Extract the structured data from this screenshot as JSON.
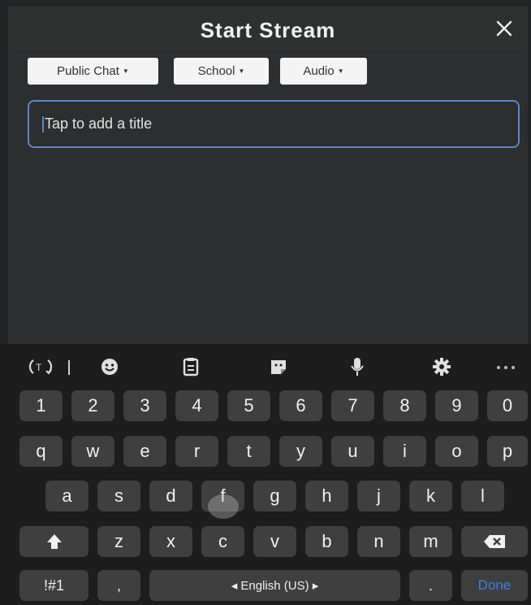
{
  "header": {
    "title": "Start Stream"
  },
  "chips": [
    {
      "label": "Public Chat"
    },
    {
      "label": "School"
    },
    {
      "label": "Audio"
    }
  ],
  "title_input": {
    "placeholder": "Tap to add a title"
  },
  "keyboard": {
    "toolbar_icons": [
      "translate-icon",
      "emoji-icon",
      "clipboard-icon",
      "sticker-icon",
      "microphone-icon",
      "settings-icon",
      "more-icon"
    ],
    "row_numbers": [
      "1",
      "2",
      "3",
      "4",
      "5",
      "6",
      "7",
      "8",
      "9",
      "0"
    ],
    "row1": [
      "q",
      "w",
      "e",
      "r",
      "t",
      "y",
      "u",
      "i",
      "o",
      "p"
    ],
    "row2": [
      "a",
      "s",
      "d",
      "f",
      "g",
      "h",
      "j",
      "k",
      "l"
    ],
    "row3": [
      "z",
      "x",
      "c",
      "v",
      "b",
      "n",
      "m"
    ],
    "symbols_label": "!#1",
    "comma_label": ",",
    "space_label": "◂  English (US)  ▸",
    "period_label": ".",
    "done_label": "Done"
  },
  "colors": {
    "accent": "#5b86c8",
    "done": "#3b7ddd",
    "background": "#232425",
    "key": "#3f3f40"
  }
}
